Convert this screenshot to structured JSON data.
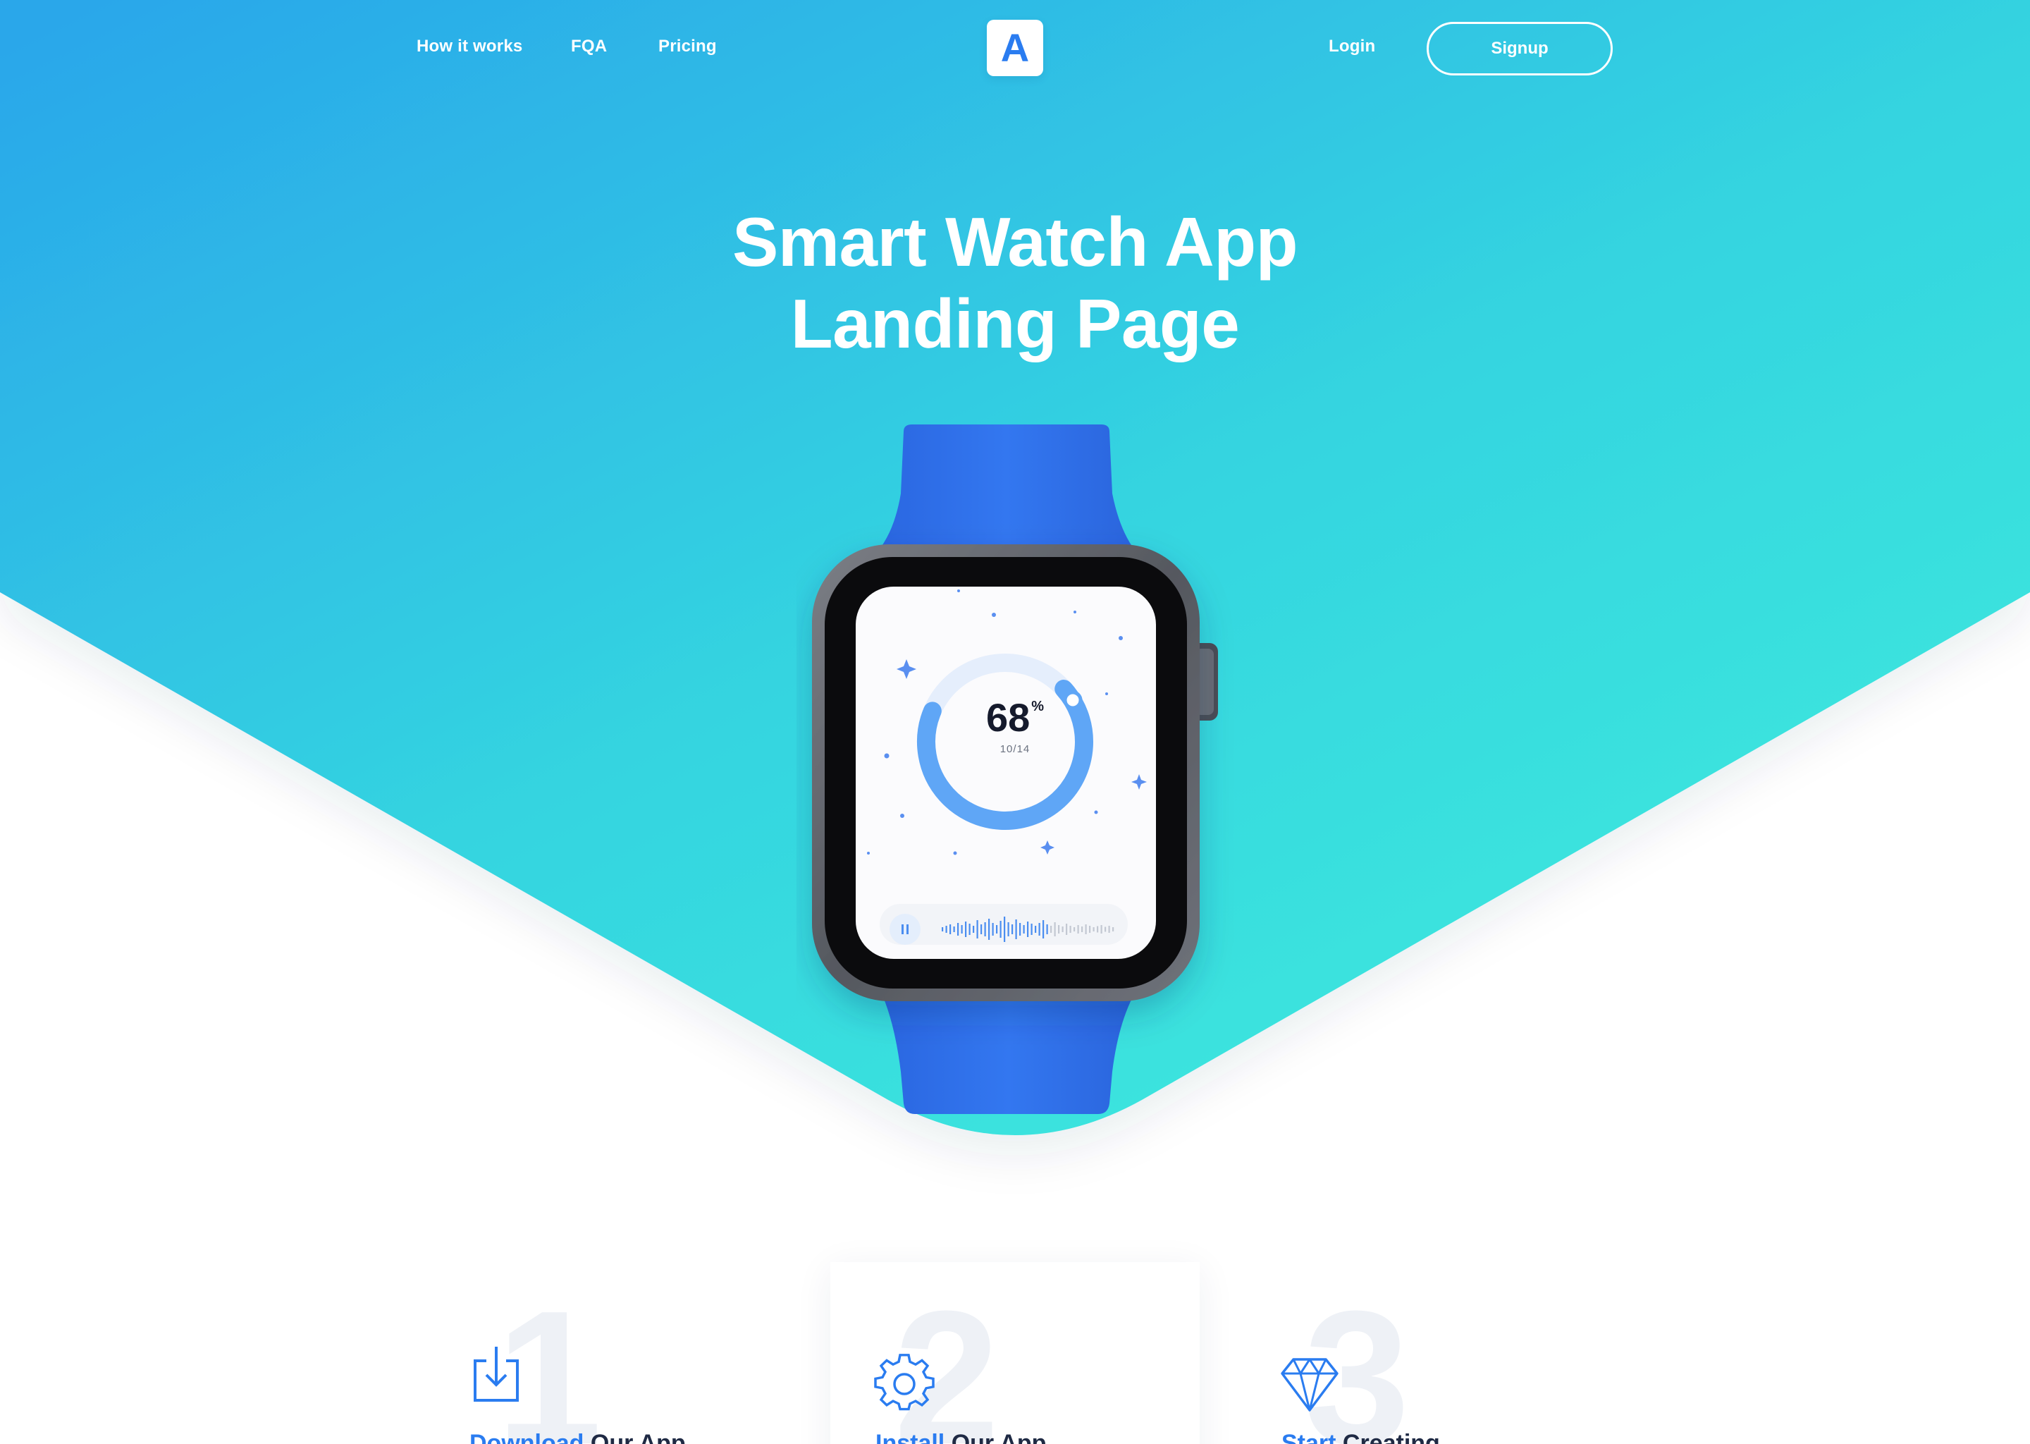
{
  "nav": {
    "links": [
      "How it works",
      "FQA",
      "Pricing"
    ],
    "logo_letter": "A",
    "login_label": "Login",
    "signup_label": "Signup"
  },
  "hero": {
    "title_line1": "Smart Watch App",
    "title_line2": "Landing Page"
  },
  "watch_screen": {
    "progress_percent": 68,
    "value": "68",
    "unit": "%",
    "sub_label": "10/14"
  },
  "steps": [
    {
      "number": "1",
      "title_accent": "Download",
      "title_rest": " Our App",
      "icon": "download-icon"
    },
    {
      "number": "2",
      "title_accent": "Install",
      "title_rest": " Our App",
      "icon": "gear-icon"
    },
    {
      "number": "3",
      "title_accent": "Start",
      "title_rest": " Creating",
      "icon": "diamond-icon"
    }
  ],
  "colors": {
    "gradient_top": "#2aa7ea",
    "gradient_bottom": "#3de6df",
    "accent": "#2a7cf0",
    "band": "#2f6ee8"
  }
}
